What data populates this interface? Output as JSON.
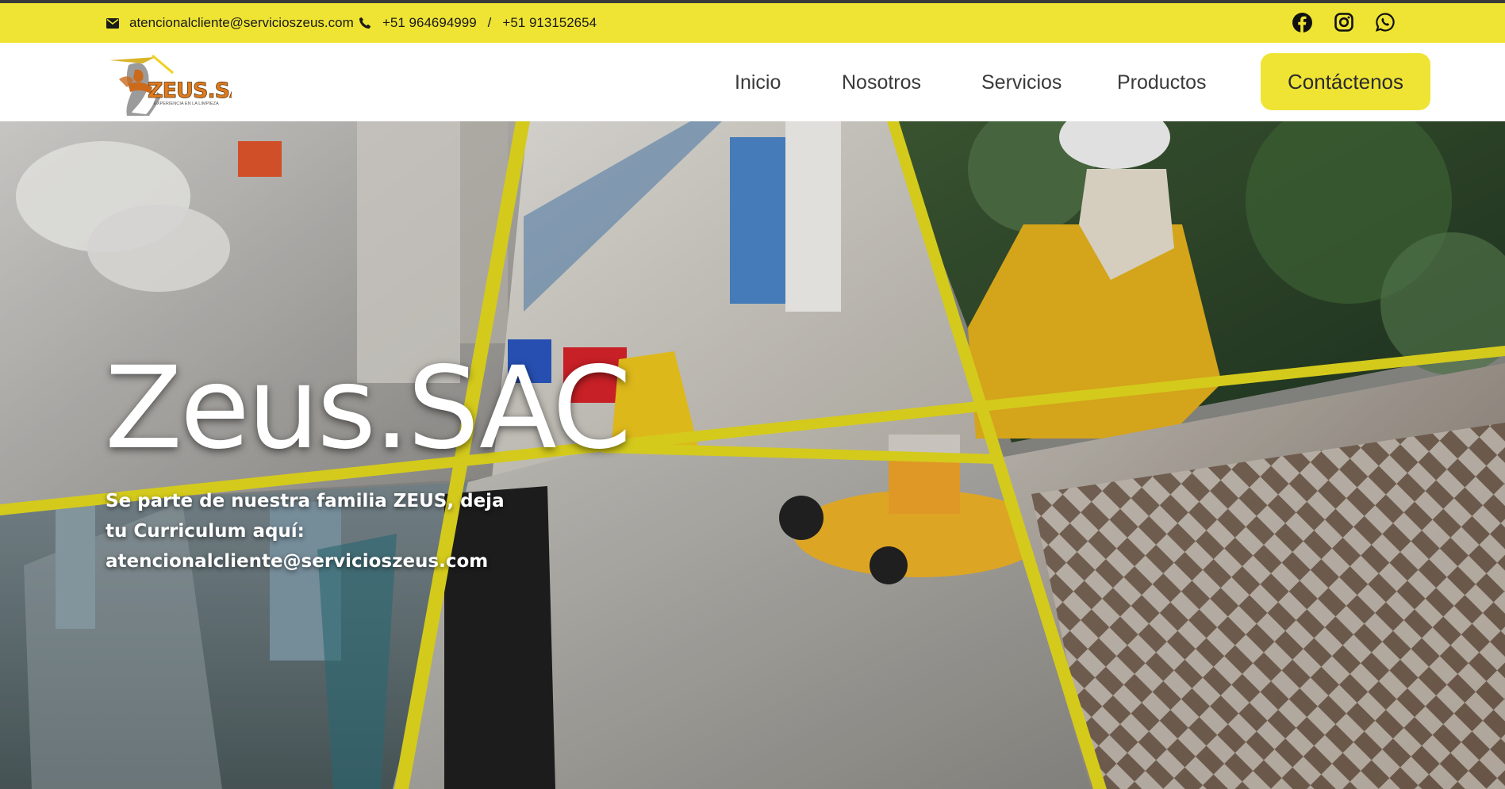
{
  "topbar": {
    "email": "atencionalcliente@servicioszeus.com",
    "phone_1": "+51 964694999",
    "phone_separator": "/",
    "phone_2": "+51 913152654",
    "social": [
      "facebook-icon",
      "instagram-icon",
      "whatsapp-icon"
    ],
    "color": "#efe434"
  },
  "logo": {
    "text": "ZEUS.SAC",
    "tagline": "EXPERIENCIA EN LA LIMPIEZA"
  },
  "nav": {
    "items": [
      "Inicio",
      "Nosotros",
      "Servicios",
      "Productos"
    ],
    "cta": "Contáctenos"
  },
  "hero": {
    "title": "Zeus.SAC",
    "subtitle": "Se parte de nuestra familia ZEUS, deja tu Curriculum aquí: atencionalcliente@servicioszeus.com"
  },
  "colors": {
    "accent": "#efe434",
    "nav_text": "#3a3a3a"
  }
}
